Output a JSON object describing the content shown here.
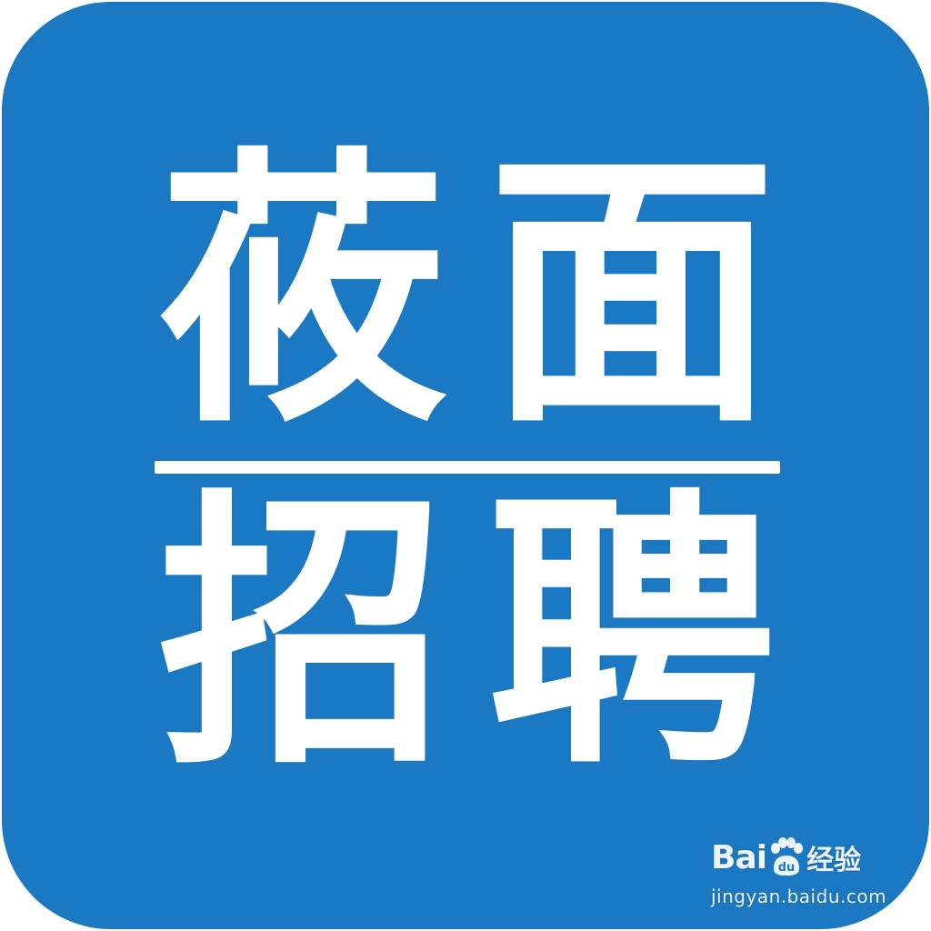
{
  "logo": {
    "line1": [
      "莜",
      "面"
    ],
    "line2": [
      "招",
      "聘"
    ],
    "background_color": "#1b78c2",
    "text_color": "#ffffff"
  },
  "watermark": {
    "brand_left": "Bai",
    "brand_paw_text": "du",
    "service": "经验",
    "url": "jingyan.baidu.com",
    "icon": "paw-icon"
  }
}
